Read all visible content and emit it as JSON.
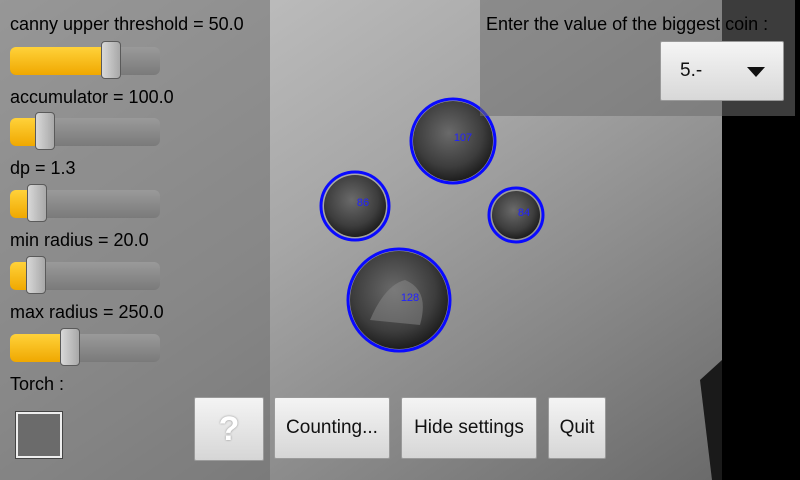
{
  "settings": {
    "sliders": [
      {
        "label": "canny upper threshold = 50.0",
        "level": 0.67
      },
      {
        "label": "accumulator = 100.0",
        "level": 0.23
      },
      {
        "label": "dp = 1.3",
        "level": 0.18
      },
      {
        "label": "min radius = 20.0",
        "level": 0.17
      },
      {
        "label": "max radius = 250.0",
        "level": 0.4
      }
    ],
    "torch_label": "Torch :",
    "torch_checked": false
  },
  "coin_value": {
    "prompt": "Enter the value of the biggest coin :",
    "selected": "5.-"
  },
  "detections": [
    {
      "label": "107"
    },
    {
      "label": "86"
    },
    {
      "label": "84"
    },
    {
      "label": "128"
    }
  ],
  "buttons": {
    "help": "?",
    "counting": "Counting...",
    "hide_settings": "Hide settings",
    "quit": "Quit"
  },
  "colors": {
    "accent": "#ffc107",
    "detection": "#0a0aff"
  }
}
